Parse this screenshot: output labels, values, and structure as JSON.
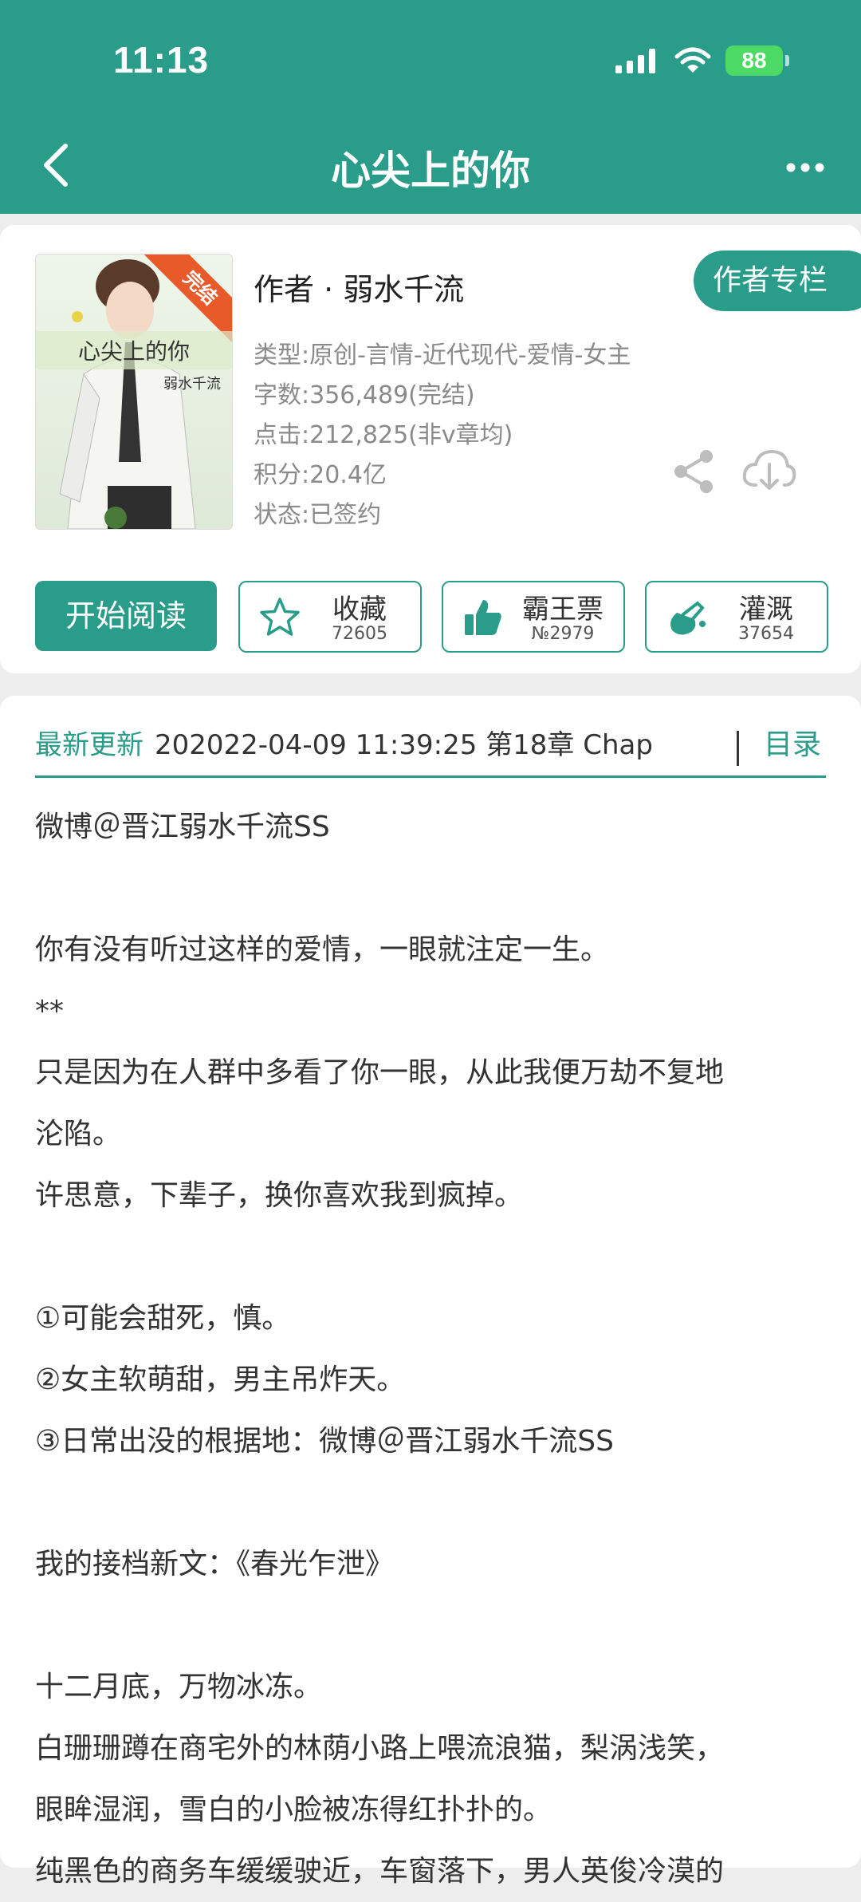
{
  "status_bar": {
    "time": "11:13",
    "battery": "88"
  },
  "nav": {
    "title": "心尖上的你"
  },
  "book": {
    "cover_badge": "完结",
    "cover_title": "心尖上的你",
    "cover_author": "弱水千流",
    "author": "作者 · 弱水千流",
    "author_column_button": "作者专栏",
    "genre": "类型:原创-言情-近代现代-爱情-女主",
    "word_count": "字数:356,489(完结)",
    "clicks": "点击:212,825(非v章均)",
    "score": "积分:20.4亿",
    "status": "状态:已签约"
  },
  "actions": {
    "read_label": "开始阅读",
    "collect": {
      "label": "收藏",
      "count": "72605"
    },
    "vote": {
      "label": "霸王票",
      "count": "№2979"
    },
    "water": {
      "label": "灌溉",
      "count": "37654"
    }
  },
  "update": {
    "label": "最新更新",
    "info": "202022-04-09 11:39:25   第18章 Chap",
    "toc_label": "目录"
  },
  "intro": [
    "微博＠晋江弱水千流SS",
    "",
    "你有没有听过这样的爱情，一眼就注定一生。",
    "**",
    "只是因为在人群中多看了你一眼，从此我便万劫不复地",
    "沦陷。",
    "许思意，下辈子，换你喜欢我到疯掉。",
    "",
    "①可能会甜死，慎。",
    "②女主软萌甜，男主吊炸天。",
    "③日常出没的根据地：微博＠晋江弱水千流SS",
    "",
    "我的接档新文：《春光乍泄》",
    "",
    "十二月底，万物冰冻。",
    "白珊珊蹲在商宅外的林荫小路上喂流浪猫，梨涡浅笑，",
    "眼眸湿润，雪白的小脸被冻得红扑扑的。",
    "纯黑色的商务车缓缓驶近，车窗落下，男人英俊冷漠的"
  ],
  "colors": {
    "accent": "#2a9c8a",
    "badge": "#e85a2a"
  }
}
